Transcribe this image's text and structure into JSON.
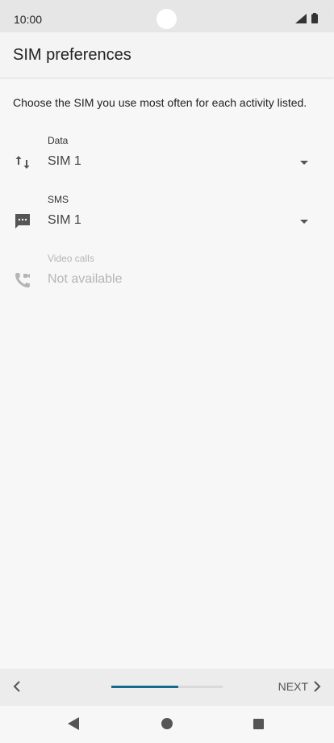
{
  "status_bar": {
    "time": "10:00"
  },
  "app_bar": {
    "title": "SIM preferences"
  },
  "description": "Choose the SIM you use most often for each activity listed.",
  "preferences": [
    {
      "label": "Data",
      "value": "SIM 1",
      "icon": "data-transfer-icon",
      "enabled": true
    },
    {
      "label": "SMS",
      "value": "SIM 1",
      "icon": "sms-icon",
      "enabled": true
    },
    {
      "label": "Video calls",
      "value": "Not available",
      "icon": "video-call-icon",
      "enabled": false
    }
  ],
  "bottom_nav": {
    "next_label": "NEXT",
    "progress": 0.6
  },
  "colors": {
    "accent": "#146b8a"
  }
}
